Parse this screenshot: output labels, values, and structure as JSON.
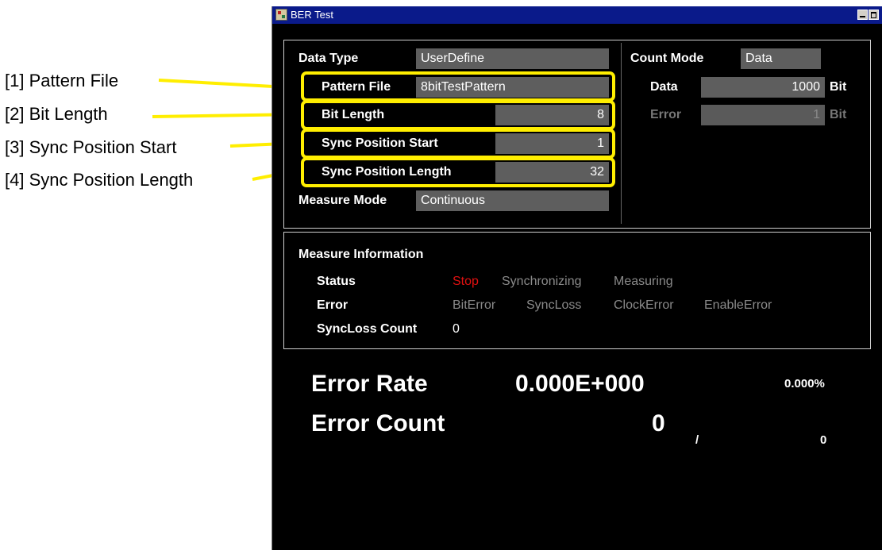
{
  "callouts": [
    {
      "label": "[1] Pattern File"
    },
    {
      "label": "[2] Bit Length"
    },
    {
      "label": "[3] Sync Position Start"
    },
    {
      "label": "[4] Sync Position Length"
    }
  ],
  "window": {
    "title": "BER Test",
    "icon": "app-icon"
  },
  "settings": {
    "data_type_label": "Data Type",
    "data_type_value": "UserDefine",
    "pattern_file_label": "Pattern File",
    "pattern_file_value": "8bitTestPattern",
    "bit_length_label": "Bit Length",
    "bit_length_value": "8",
    "sync_start_label": "Sync Position Start",
    "sync_start_value": "1",
    "sync_length_label": "Sync Position Length",
    "sync_length_value": "32",
    "measure_mode_label": "Measure Mode",
    "measure_mode_value": "Continuous",
    "count_mode_label": "Count Mode",
    "count_mode_value": "Data",
    "data_label": "Data",
    "data_value": "1000",
    "data_unit": "Bit",
    "error_label": "Error",
    "error_value": "1",
    "error_unit": "Bit"
  },
  "measure_info": {
    "title": "Measure Information",
    "status_label": "Status",
    "status_stop": "Stop",
    "status_sync": "Synchronizing",
    "status_measuring": "Measuring",
    "error_label": "Error",
    "error_bit": "BitError",
    "error_syncloss": "SyncLoss",
    "error_clock": "ClockError",
    "error_enable": "EnableError",
    "syncloss_label": "SyncLoss Count",
    "syncloss_value": "0"
  },
  "results": {
    "error_rate_label": "Error Rate",
    "error_rate_value": "0.000E+000",
    "error_rate_percent": "0.000%",
    "error_count_label": "Error Count",
    "error_count_value": "0",
    "separator": "/",
    "total_count": "0"
  },
  "colors": {
    "highlight": "#ffee00",
    "status_active": "#e01010",
    "field_bg": "#5e5e5e",
    "title_bar": "#0a1a8a"
  }
}
